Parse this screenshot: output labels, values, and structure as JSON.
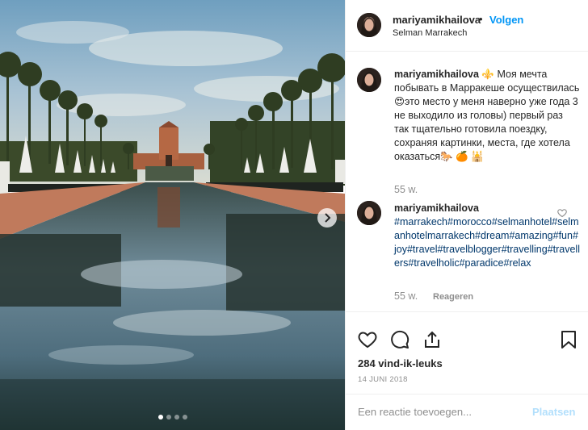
{
  "post": {
    "username": "mariyamikhailova",
    "dot": "•",
    "follow_label": "Volgen",
    "location": "Selman Marrakech"
  },
  "comments": [
    {
      "username": "mariyamikhailova",
      "text": "⚜️ Моя мечта побывать в Марракеше осуществилась😍это место у меня наверно уже года 3 не выходило из головы) первый раз так тщательно готовила поездку, сохраняя картинки, места, где хотела оказаться🐎 🍊 🕌",
      "time": "55 w."
    },
    {
      "username": "mariyamikhailova",
      "hashtags": "#marrakech#morocco#selmanhotel#selmanhotelmarrakech#dream#amazing#fun#joy#travel#travelblogger#travelling#travellers#travelholic#paradice#relax",
      "time": "55 w.",
      "reply_label": "Reageren"
    }
  ],
  "actions": {
    "like_icon": "heart-icon",
    "comment_icon": "comment-icon",
    "share_icon": "share-icon",
    "save_icon": "bookmark-icon"
  },
  "likes": "284 vind-ik-leuks",
  "date": "14 JUNI 2018",
  "add_comment": {
    "placeholder": "Een reactie toevoegen...",
    "post_label": "Plaatsen"
  },
  "carousel": {
    "slide_count": 4,
    "active_index": 0
  },
  "colors": {
    "link": "#0095f6",
    "hashtag": "#00376b",
    "muted": "#8e8e8e",
    "post_disabled": "#b2dffc"
  }
}
